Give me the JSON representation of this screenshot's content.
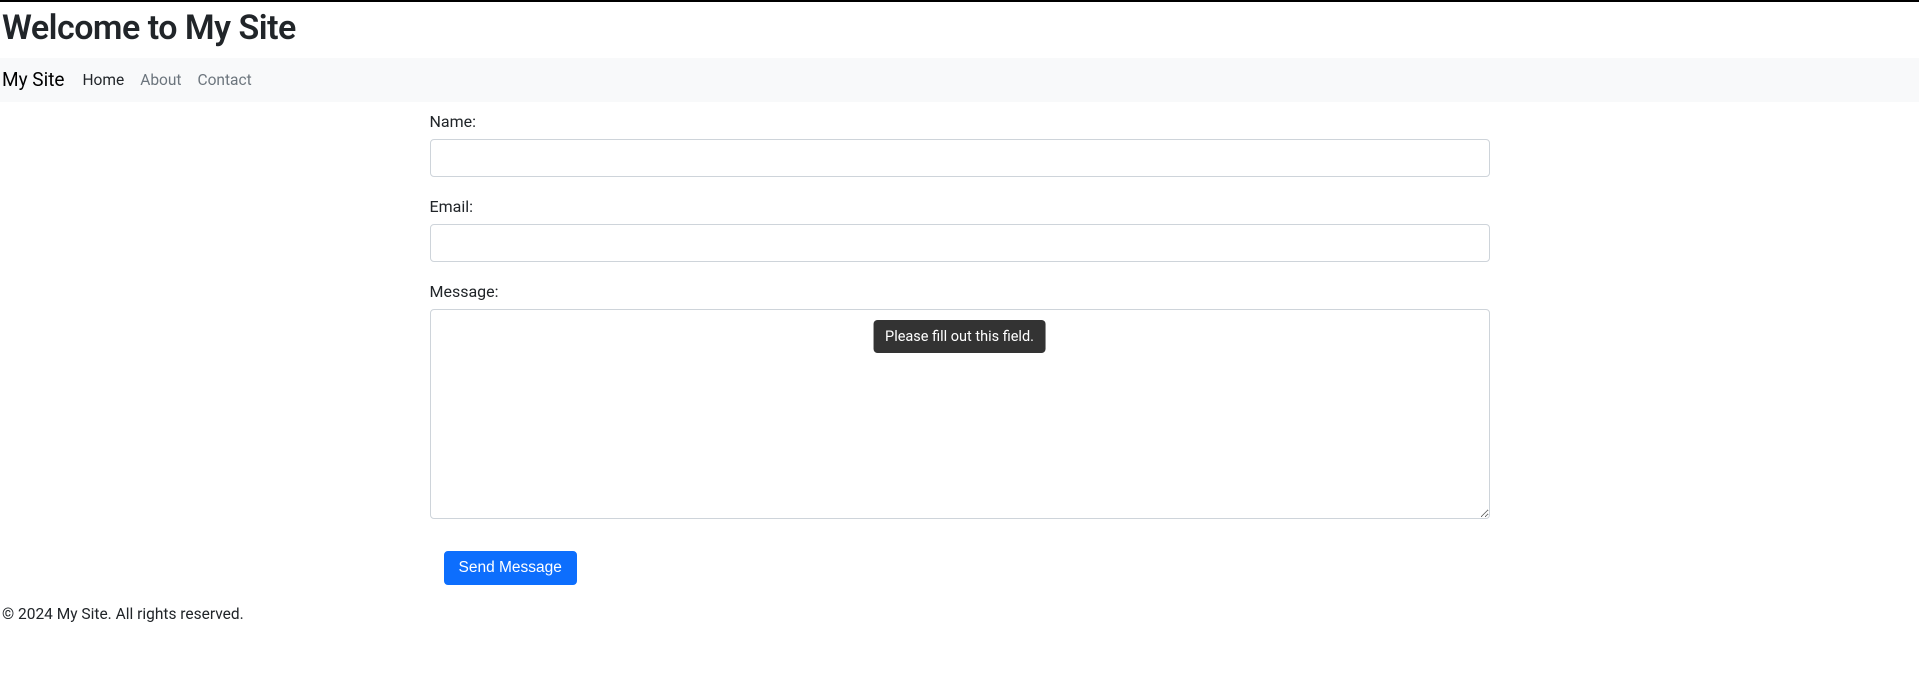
{
  "header": {
    "title": "Welcome to My Site"
  },
  "navbar": {
    "brand": "My Site",
    "links": {
      "home": "Home",
      "about": "About",
      "contact": "Contact"
    }
  },
  "form": {
    "name_label": "Name:",
    "name_value": "",
    "email_label": "Email:",
    "email_value": "",
    "message_label": "Message:",
    "message_value": "",
    "submit_label": "Send Message"
  },
  "validation": {
    "tooltip": "Please fill out this field."
  },
  "footer": {
    "text": "© 2024 My Site. All rights reserved."
  }
}
